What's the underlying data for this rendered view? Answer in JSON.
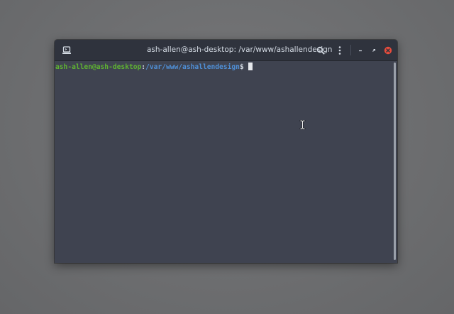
{
  "window": {
    "title": "ash-allen@ash-desktop: /var/www/ashallendesign"
  },
  "titlebar": {
    "left_icon": "terminal-icon",
    "search_icon": "search-icon",
    "menu_icon": "kebab-menu-icon",
    "minimize_icon": "minimize-icon",
    "restore_icon": "restore-icon",
    "close_icon": "close-icon"
  },
  "terminal": {
    "prompt_user": "ash-allen@ash-desktop",
    "prompt_colon": ":",
    "prompt_path": "/var/www/ashallendesign",
    "prompt_dollar": "$"
  },
  "colors": {
    "prompt_user": "#5fb332",
    "prompt_path": "#4f8fd6",
    "close_button": "#e74c3c",
    "terminal_bg": "#3f4350",
    "titlebar_bg": "#2f333d"
  }
}
